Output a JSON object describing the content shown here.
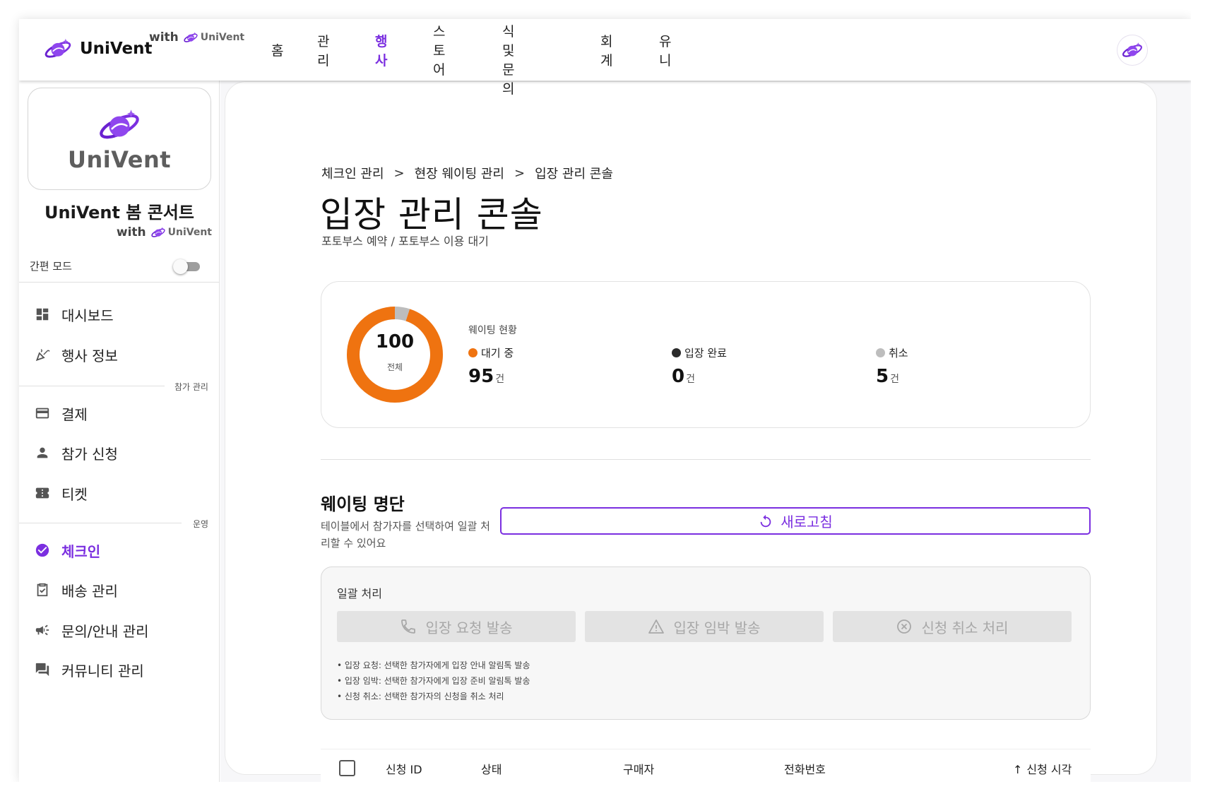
{
  "colors": {
    "accent": "#7b2fe0",
    "waiting": "#ef7310",
    "done": "#2b2b2b",
    "cancel": "#bdbdbd"
  },
  "header": {
    "brand": "UniVent",
    "with": "with",
    "with_brand": "UniVent",
    "nav": [
      "홈",
      "관리",
      "행사",
      "스토어",
      "소식 및 문의",
      "회계",
      "유니"
    ],
    "active_nav": "행사"
  },
  "sidebar": {
    "logo_text": "UniVent",
    "event_title": "UniVent 봄 콘서트",
    "with": "with",
    "with_brand": "UniVent",
    "simple_mode": "간편 모드",
    "simple_mode_on": false,
    "sections": {
      "participation": "참가 관리",
      "operations": "운영"
    },
    "items": [
      {
        "label": "대시보드",
        "icon": "dashboard-icon"
      },
      {
        "label": "행사 정보",
        "icon": "celebration-icon"
      },
      {
        "label": "결제",
        "icon": "credit-card-icon"
      },
      {
        "label": "참가 신청",
        "icon": "person-icon"
      },
      {
        "label": "티켓",
        "icon": "ticket-icon"
      },
      {
        "label": "체크인",
        "icon": "check-circle-icon",
        "active": true
      },
      {
        "label": "배송 관리",
        "icon": "clipboard-icon"
      },
      {
        "label": "문의/안내 관리",
        "icon": "campaign-icon"
      },
      {
        "label": "커뮤니티 관리",
        "icon": "forum-icon"
      }
    ]
  },
  "main": {
    "breadcrumb": [
      "체크인 관리",
      "현장 웨이팅 관리",
      "입장 관리 콘솔"
    ],
    "title": "입장 관리 콘솔",
    "subtitle": "포토부스 예약 / 포토부스 이용 대기",
    "stats": {
      "total": "100",
      "total_label": "전체",
      "label": "웨이팅 현황",
      "unit": "건",
      "items": [
        {
          "name": "대기 중",
          "value": 95,
          "color": "#ef7310"
        },
        {
          "name": "입장 완료",
          "value": 0,
          "color": "#2b2b2b"
        },
        {
          "name": "취소",
          "value": 5,
          "color": "#bdbdbd"
        }
      ]
    },
    "waitlist": {
      "title": "웨이팅 명단",
      "desc": "테이블에서 참가자를 선택하여 일괄 처리할 수 있어요",
      "refresh": "새로고침"
    },
    "bulk": {
      "title": "일괄 처리",
      "buttons": [
        {
          "label": "입장 요청 발송",
          "icon": "phone-icon"
        },
        {
          "label": "입장 임박 발송",
          "icon": "warning-icon"
        },
        {
          "label": "신청 취소 처리",
          "icon": "cancel-circle-icon"
        }
      ],
      "notes": [
        "• 입장 요청: 선택한 참가자에게 입장 안내 알림톡 발송",
        "• 입장 임박: 선택한 참가자에게 입장 준비 알림톡 발송",
        "• 신청 취소: 선택한 참가자의 신청을 취소 처리"
      ]
    },
    "table": {
      "columns": [
        "신청 ID",
        "상태",
        "구매자",
        "전화번호",
        "신청 시각"
      ],
      "sorted_column": "신청 시각",
      "sort_direction": "ascending"
    }
  }
}
